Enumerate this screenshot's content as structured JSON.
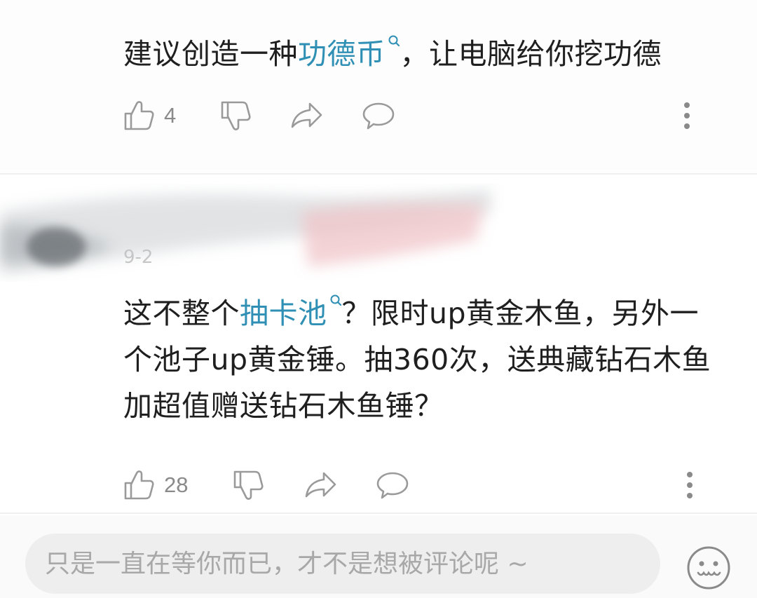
{
  "comments": [
    {
      "text_before": "建议创造一种",
      "link": "功德币",
      "text_after": "，让电脑给你挖功德",
      "likes": "4"
    },
    {
      "date_fragment": "9-2",
      "text_before": "这不整个",
      "link": "抽卡池",
      "text_after": "？限时up黄金木鱼，另外一个池子up黄金锤。抽360次，送典藏钻石木鱼加超值赠送钻石木鱼锤？",
      "likes": "28"
    }
  ],
  "input": {
    "placeholder": "只是一直在等你而已，才不是想被评论呢 ~"
  },
  "colors": {
    "link": "#2f8fb4",
    "icon": "#9a9a9a",
    "text": "#1f1f1f"
  },
  "icons": [
    "thumb-up-icon",
    "thumb-down-icon",
    "share-icon",
    "reply-icon",
    "more-vertical-icon",
    "search-icon",
    "emoji-icon"
  ]
}
